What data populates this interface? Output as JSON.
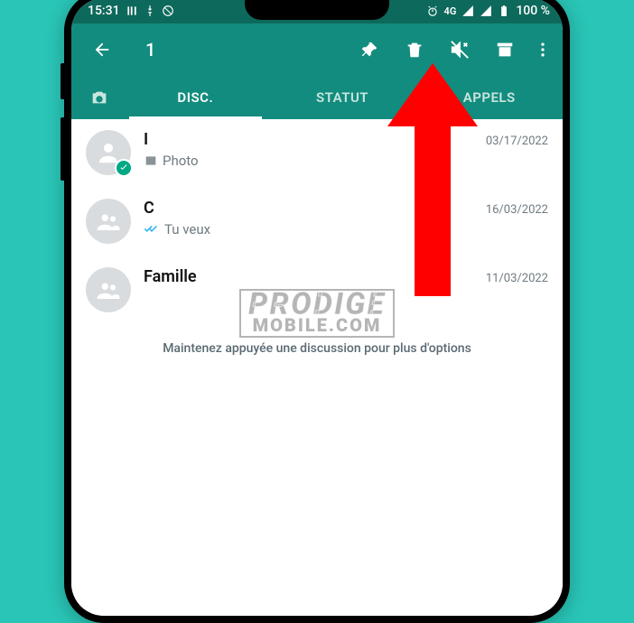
{
  "status": {
    "time": "15:31",
    "network_label": "4G",
    "battery_text": "100 %"
  },
  "selection": {
    "count": "1"
  },
  "tabs": {
    "disc": "DISC.",
    "statut": "STATUT",
    "appels": "APPELS"
  },
  "chats": [
    {
      "name": "I",
      "date": "03/17/2022",
      "subtitle_kind": "photo",
      "subtitle_text": "Photo",
      "selected": true,
      "avatar_kind": "person"
    },
    {
      "name": "C",
      "date": "16/03/2022",
      "subtitle_kind": "read",
      "subtitle_text": "Tu veux",
      "selected": false,
      "avatar_kind": "group"
    },
    {
      "name": "Famille",
      "date": "11/03/2022",
      "subtitle_kind": "none",
      "subtitle_text": "",
      "selected": false,
      "avatar_kind": "group"
    }
  ],
  "hint": "Maintenez appuyée une discussion pour plus d'options",
  "watermark": {
    "line1": "PRODIGE",
    "line2": "MOBILE.COM"
  },
  "colors": {
    "brand_dark": "#128C7E",
    "brand_darker": "#0d695b",
    "accent_read": "#34b7f1",
    "accent_check": "#00a884",
    "arrow": "#ff0000",
    "page_bg": "#29c5b6"
  }
}
